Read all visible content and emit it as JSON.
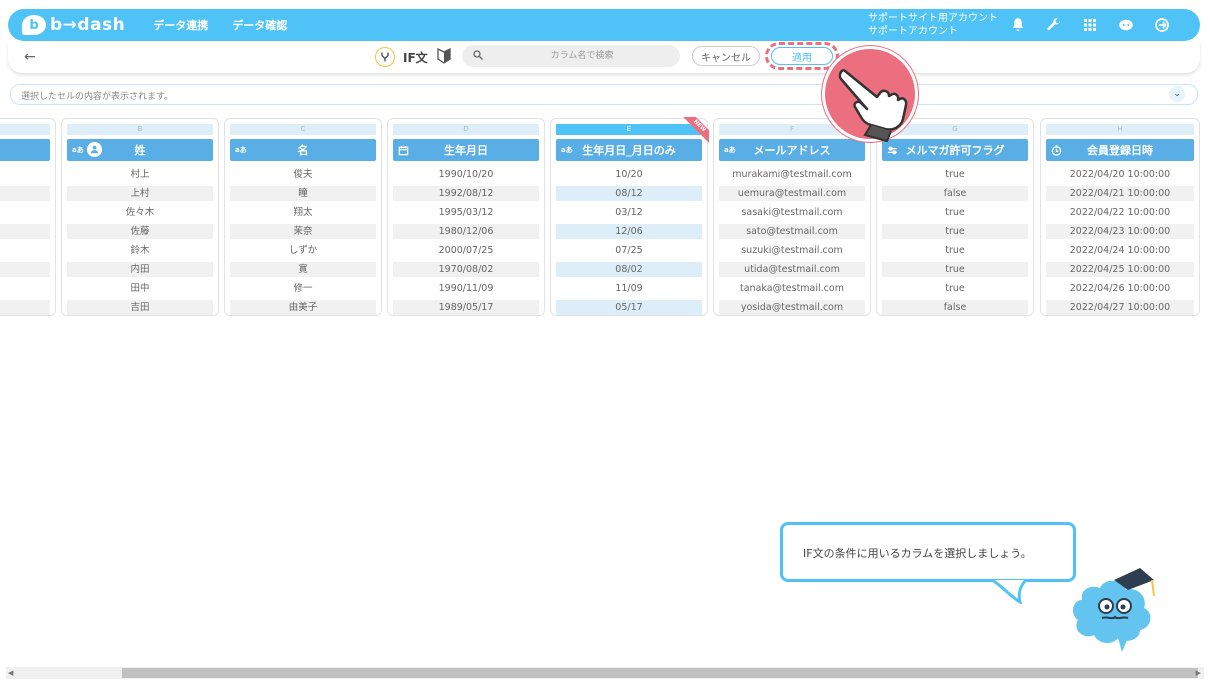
{
  "header": {
    "logo_mark": "b",
    "logo_text": "b→dash",
    "nav": [
      "データ連携",
      "データ確認"
    ],
    "account_line1": "サポートサイト用アカウント",
    "account_line2": "サポートアカウント",
    "icons": [
      "bell-icon",
      "wrench-icon",
      "apps-grid-icon",
      "support-chat-icon",
      "logout-icon"
    ]
  },
  "toolbar": {
    "back_icon": "←",
    "if_label": "IF文",
    "search_placeholder": "カラム名で検索",
    "cancel_label": "キャンセル",
    "apply_label": "適用"
  },
  "cellbar": {
    "placeholder": "選択したセルの内容が表示されます。",
    "chevron": "⌄"
  },
  "columns": [
    {
      "letter": "",
      "title": "",
      "type": "",
      "cells": [
        "",
        "",
        "",
        "",
        "",
        "",
        "",
        ""
      ]
    },
    {
      "letter": "B",
      "title": "姓",
      "type": "aあ",
      "cells": [
        "村上",
        "上村",
        "佐々木",
        "佐藤",
        "鈴木",
        "内田",
        "田中",
        "吉田"
      ]
    },
    {
      "letter": "C",
      "title": "名",
      "type": "aあ",
      "cells": [
        "俊夫",
        "瞳",
        "翔太",
        "茉奈",
        "しずか",
        "寛",
        "修一",
        "由美子"
      ]
    },
    {
      "letter": "D",
      "title": "生年月日",
      "type": "calendar",
      "cells": [
        "1990/10/20",
        "1992/08/12",
        "1995/03/12",
        "1980/12/06",
        "2000/07/25",
        "1970/08/02",
        "1990/11/09",
        "1989/05/17"
      ]
    },
    {
      "letter": "E",
      "title": "生年月日_月日のみ",
      "type": "aあ",
      "badge": "NEW",
      "cells": [
        "10/20",
        "08/12",
        "03/12",
        "12/06",
        "07/25",
        "08/02",
        "11/09",
        "05/17"
      ]
    },
    {
      "letter": "F",
      "title": "メールアドレス",
      "type": "aあ",
      "cells": [
        "murakami@testmail.com",
        "uemura@testmail.com",
        "sasaki@testmail.com",
        "sato@testmail.com",
        "suzuki@testmail.com",
        "utida@testmail.com",
        "tanaka@testmail.com",
        "yosida@testmail.com"
      ]
    },
    {
      "letter": "G",
      "title": "メルマガ許可フラグ",
      "type": "toggle",
      "cells": [
        "true",
        "false",
        "true",
        "true",
        "true",
        "true",
        "true",
        "false"
      ]
    },
    {
      "letter": "H",
      "title": "会員登録日時",
      "type": "clock",
      "cells": [
        "2022/04/20 10:00:00",
        "2022/04/21 10:00:00",
        "2022/04/22 10:00:00",
        "2022/04/23 10:00:00",
        "2022/04/24 10:00:00",
        "2022/04/25 10:00:00",
        "2022/04/26 10:00:00",
        "2022/04/27 10:00:00"
      ]
    }
  ],
  "tooltip": {
    "text": "IF文の条件に用いるカラムを選択しましょう。"
  },
  "scrollbar": {
    "left_arrow": "◀",
    "right_arrow": "▶"
  },
  "colors": {
    "accent": "#4fc3f7",
    "header_blue": "#5aaee6",
    "highlight_pink": "#ec6f7f"
  }
}
